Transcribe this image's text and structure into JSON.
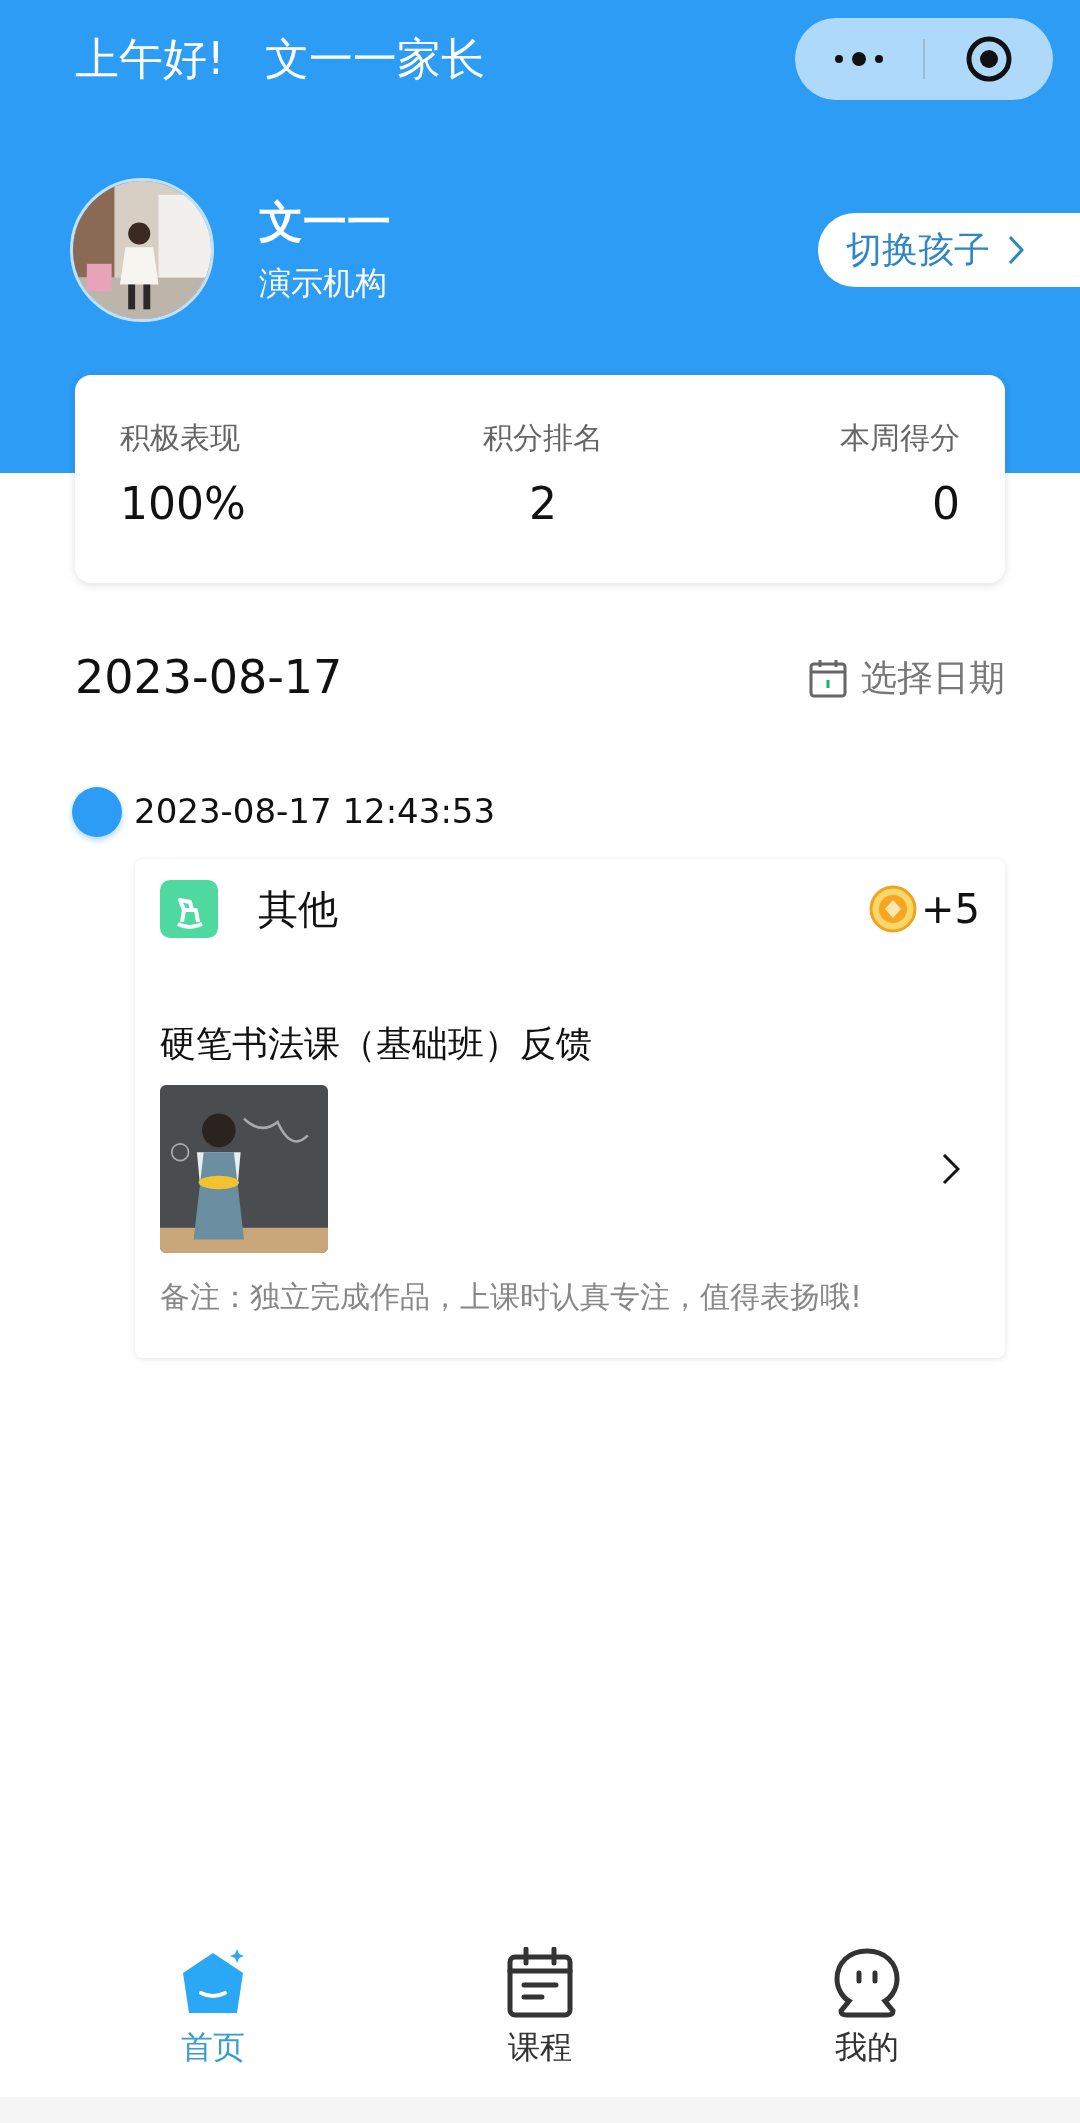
{
  "header": {
    "greeting": "上午好!",
    "parent_name": "文一一家长"
  },
  "child": {
    "name": "文一一",
    "organization": "演示机构",
    "switch_button": "切换孩子"
  },
  "stats": [
    {
      "label": "积极表现",
      "value": "100%"
    },
    {
      "label": "积分排名",
      "value": "2"
    },
    {
      "label": "本周得分",
      "value": "0"
    }
  ],
  "date": "2023-08-17",
  "select_date": "选择日期",
  "timeline": [
    {
      "time": "2023-08-17 12:43:53",
      "category": "其他",
      "points": "+5",
      "title": "硬笔书法课（基础班）反馈",
      "note": "备注：独立完成作品，上课时认真专注，值得表扬哦!"
    }
  ],
  "tabs": [
    {
      "label": "首页",
      "selected": true,
      "kind": "home"
    },
    {
      "label": "课程",
      "selected": false,
      "kind": "calendar"
    },
    {
      "label": "我的",
      "selected": false,
      "kind": "profile"
    }
  ]
}
